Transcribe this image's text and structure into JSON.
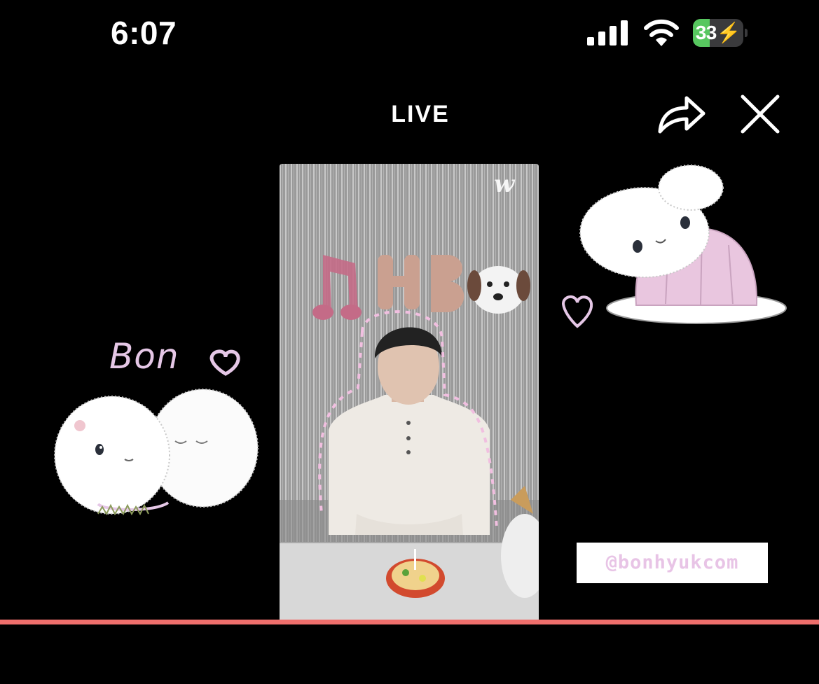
{
  "status_bar": {
    "time": "6:07",
    "battery_level": "33",
    "battery_fraction": 0.33,
    "battery_charging": true
  },
  "header": {
    "title": "LIVE",
    "share_icon": "share-arrow-icon",
    "close_icon": "close-icon"
  },
  "video": {
    "app_logo": "w",
    "balloons": [
      "H",
      "B"
    ],
    "progress_fraction": 1.0
  },
  "stickers": {
    "left_caption": "Bon",
    "right_icon": "heart-icon"
  },
  "watermark": "@bonhyukcom",
  "colors": {
    "background": "#000000",
    "progress": "#ef6f6c",
    "battery_fill": "#57c75f",
    "sticker_pink": "#e5c7e6"
  }
}
